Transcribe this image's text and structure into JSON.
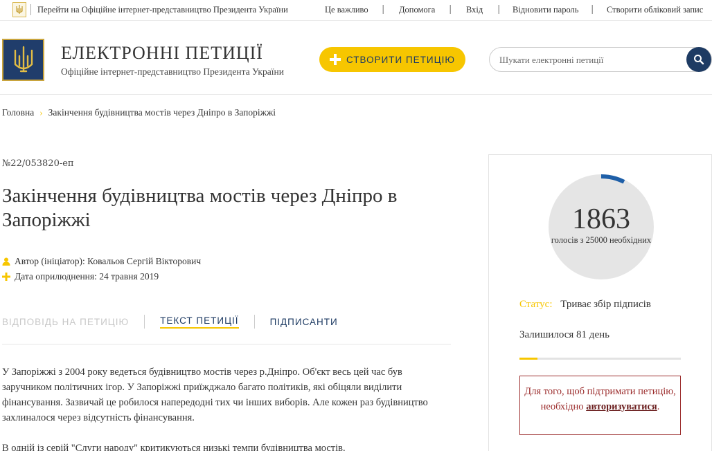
{
  "topbar": {
    "official_link": "Перейти на Офіційне інтернет-представництво Президента України",
    "important": "Це важливо",
    "help": "Допомога",
    "login": "Вхід",
    "restore_password": "Відновити пароль",
    "create_account": "Створити обліковий запис"
  },
  "header": {
    "title": "ЕЛЕКТРОННІ ПЕТИЦІЇ",
    "subtitle": "Офіційне інтернет-представництво Президента України",
    "create_button": "СТВОРИТИ ПЕТИЦІЮ",
    "search_placeholder": "Шукати електронні петиції"
  },
  "breadcrumb": {
    "home": "Головна",
    "current": "Закінчення будівництва мостів через Дніпро в Запоріжжі"
  },
  "petition": {
    "number": "№22/053820-еп",
    "title": "Закінчення будівництва мостів через Дніпро в Запоріжжі",
    "author": "Автор (ініціатор): Ковальов Сергій Вікторович",
    "date": "Дата оприлюднення: 24 травня 2019",
    "body": [
      "У Запоріжжі з 2004 року ведеться будівництво мостів через р.Дніпро. Об'єкт весь цей час був заручником політичних ігор. У Запоріжжі приїжджало багато політиків, які обіцяли виділити фінансування. Зазвичай це робилося напередодні тих чи інших виборів. Але кожен раз будівництво захлиналося через відсутність фінансування.",
      "В одній із серій \"Слуги народу\" критикуються низькі темпи будівництва мостів."
    ]
  },
  "tabs": {
    "answer": "ВІДПОВІДЬ НА ПЕТИЦІЮ",
    "text": "ТЕКСТ ПЕТИЦІЇ",
    "signers": "ПІДПИСАНТИ"
  },
  "stats": {
    "votes": "1863",
    "votes_needed_text": "голосів з 25000 необхідних",
    "votes_value": 1863,
    "votes_target": 25000,
    "status_label": "Статус:",
    "status_value": "Триває збір підписів",
    "remaining": "Залишилося 81 день",
    "time_progress_fraction": 0.11
  },
  "notice": {
    "text_before": "Для того, щоб підтримати петицію, необхідно",
    "link": "авторизуватися",
    "text_after": "."
  },
  "colors": {
    "accent_yellow": "#f7c600",
    "navy": "#1e3b63",
    "notice_red": "#9b2c2c"
  }
}
